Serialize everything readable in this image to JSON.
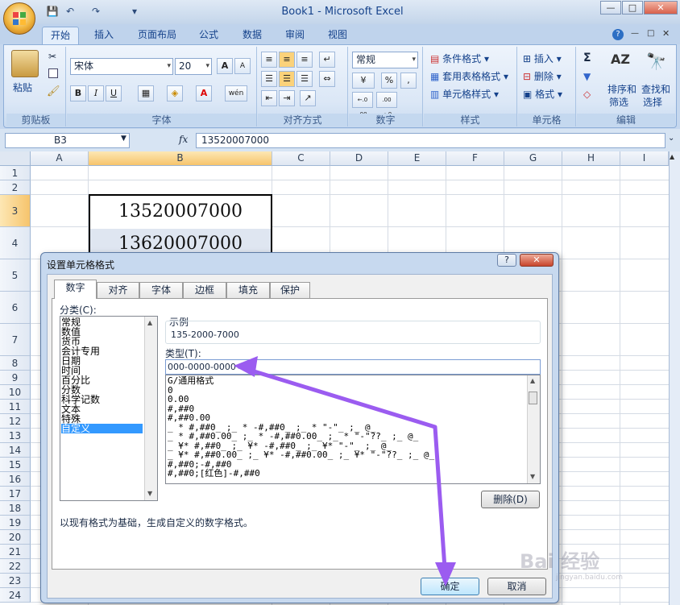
{
  "window": {
    "title": "Book1 - Microsoft Excel",
    "min": "—",
    "max": "□",
    "close": "✕"
  },
  "qat": {
    "save": "💾",
    "undo": "↶",
    "redo": "↷",
    "customize": "▾"
  },
  "tabs": [
    "开始",
    "插入",
    "页面布局",
    "公式",
    "数据",
    "审阅",
    "视图"
  ],
  "ribbon": {
    "clipboard": {
      "paste": "粘贴",
      "title": "剪贴板"
    },
    "font": {
      "name": "宋体",
      "size": "20",
      "grow": "A",
      "shrink": "A",
      "bold": "B",
      "italic": "I",
      "underline": "U",
      "phonetic": "wén",
      "fontcolor": "A",
      "title": "字体"
    },
    "alignment": {
      "title": "对齐方式"
    },
    "number": {
      "format": "常规",
      "percent": "%",
      "comma": ",",
      "inc": "←.0 .00",
      "dec": ".00 →.0",
      "title": "数字"
    },
    "styles": {
      "cond": "条件格式",
      "table": "套用表格格式",
      "cell": "单元格样式",
      "title": "样式"
    },
    "cells": {
      "insert": "插入",
      "delete": "删除",
      "format": "格式",
      "title": "单元格"
    },
    "editing": {
      "sum": "Σ",
      "sort": "排序和",
      "sort2": "筛选",
      "find": "查找和",
      "find2": "选择",
      "title": "编辑"
    }
  },
  "formula_bar": {
    "name_box": "B3",
    "fx": "fx",
    "value": "13520007000"
  },
  "columns": [
    "A",
    "B",
    "C",
    "D",
    "E",
    "F",
    "G",
    "H",
    "I"
  ],
  "rows": [
    "1",
    "2",
    "3",
    "4",
    "5",
    "6",
    "7",
    "8",
    "9",
    "10",
    "11",
    "12",
    "13",
    "14",
    "15",
    "16",
    "17",
    "18",
    "19",
    "20",
    "21",
    "22",
    "23",
    "24"
  ],
  "cells": {
    "b3": "13520007000",
    "b4": "13620007000"
  },
  "dialog": {
    "title": "设置单元格格式",
    "help": "?",
    "close": "✕",
    "tabs": [
      "数字",
      "对齐",
      "字体",
      "边框",
      "填充",
      "保护"
    ],
    "category_label": "分类(C):",
    "categories": [
      "常规",
      "数值",
      "货币",
      "会计专用",
      "日期",
      "时间",
      "百分比",
      "分数",
      "科学记数",
      "文本",
      "特殊",
      "自定义"
    ],
    "sample_label": "示例",
    "sample_value": "135-2000-7000",
    "type_label": "类型(T):",
    "type_value": "000-0000-0000",
    "formats": [
      "G/通用格式",
      "0",
      "0.00",
      "#,##0",
      "#,##0.00",
      "_ * #,##0_ ;_ * -#,##0_ ;_ * \"-\"_ ;_ @_",
      "_ * #,##0.00_ ;_ * -#,##0.00_ ;_ * \"-\"??_ ;_ @_",
      "_ ¥* #,##0_ ;_ ¥* -#,##0_ ;_ ¥* \"-\"_ ;_ @_",
      "_ ¥* #,##0.00_ ;_ ¥* -#,##0.00_ ;_ ¥* \"-\"??_ ;_ @_",
      "#,##0;-#,##0",
      "#,##0;[红色]-#,##0"
    ],
    "delete_button": "删除(D)",
    "description": "以现有格式为基础，生成自定义的数字格式。",
    "ok_button": "确定",
    "cancel_button": "取消"
  },
  "watermark": "Bai 经验",
  "watermark_url": "jingyan.baidu.com",
  "colors": {
    "arrow": "#9b5cf0",
    "selected": "#3399ff",
    "header_sel": "#f6c46c"
  }
}
